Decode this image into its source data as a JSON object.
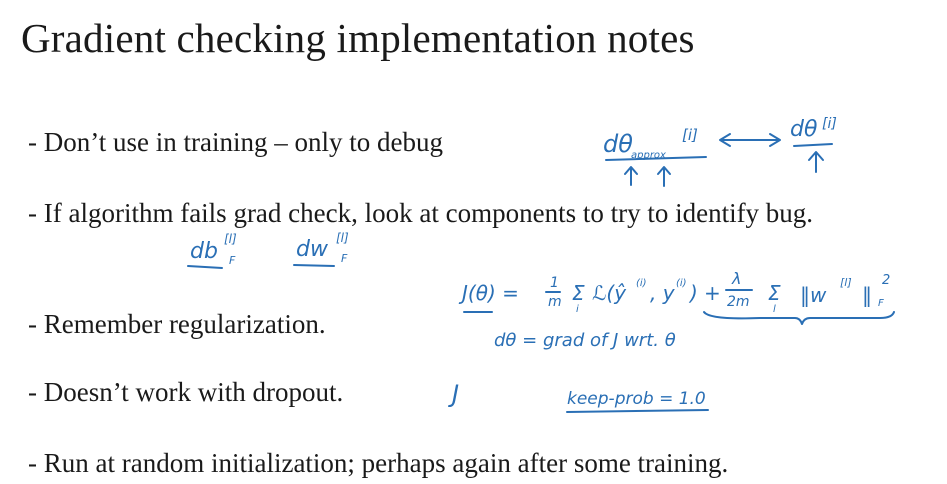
{
  "title": "Gradient checking implementation notes",
  "bullets": [
    "- Don’t use in training – only to debug",
    "- If algorithm fails grad check, look at components to try to identify bug.",
    "- Remember regularization.",
    "- Doesn’t work with dropout.",
    "- Run at random initialization; perhaps again after some training."
  ],
  "annotations": {
    "dtheta_approx": "dθ",
    "approx_sub": "approx",
    "index_i": "[i]",
    "dtheta_i": "dθ",
    "index_i2": "[i]",
    "db": "db",
    "db_sup": "[l]",
    "dw": "dw",
    "dw_sup": "[l]",
    "cost_lhs": "J(θ) =",
    "frac_1": "1",
    "frac_m": "m",
    "sum_main": "Σ",
    "sum_i": "i",
    "loss_term": "ℒ(ŷ",
    "loss_sup": "(i)",
    "loss_y": ", y",
    "loss_y_sup": "(i)",
    "loss_close": ")",
    "plus": "+",
    "lambda": "λ",
    "two_m": "2m",
    "sum_reg": "Σ",
    "sum_l": "l",
    "norm_w": "‖w",
    "norm_sup": "[l]",
    "norm_close": "‖",
    "norm_sq": "2",
    "norm_f": "F",
    "grad_def": "dθ = grad of J wrt. θ",
    "j_letter": "J",
    "keep_prob": "keep-prob = 1.0"
  }
}
